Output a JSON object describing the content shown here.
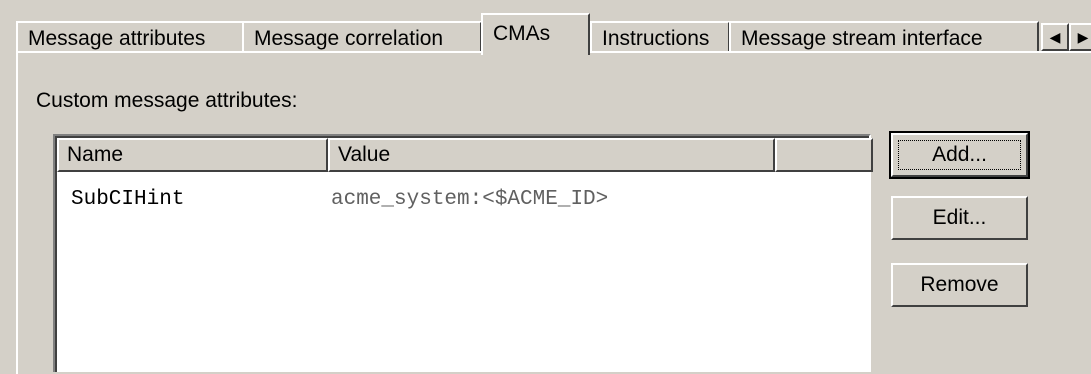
{
  "tabs": [
    {
      "label": "Message attributes",
      "active": false
    },
    {
      "label": "Message correlation",
      "active": false
    },
    {
      "label": "CMAs",
      "active": true
    },
    {
      "label": "Instructions",
      "active": false
    },
    {
      "label": "Message stream interface",
      "active": false
    }
  ],
  "tab_scroll": {
    "left_icon": "left-arrow-icon",
    "right_icon": "right-arrow-icon",
    "left_glyph": "◀",
    "right_glyph": "▶"
  },
  "cma": {
    "group_label": "Custom message attributes:",
    "columns": [
      "Name",
      "Value"
    ],
    "rows": [
      {
        "name": "SubCIHint",
        "value": "acme_system:<$ACME_ID>"
      }
    ]
  },
  "buttons": {
    "add": "Add...",
    "edit": "Edit...",
    "remove": "Remove"
  },
  "colors": {
    "face": "#d4d0c8",
    "value_text": "#606060"
  }
}
